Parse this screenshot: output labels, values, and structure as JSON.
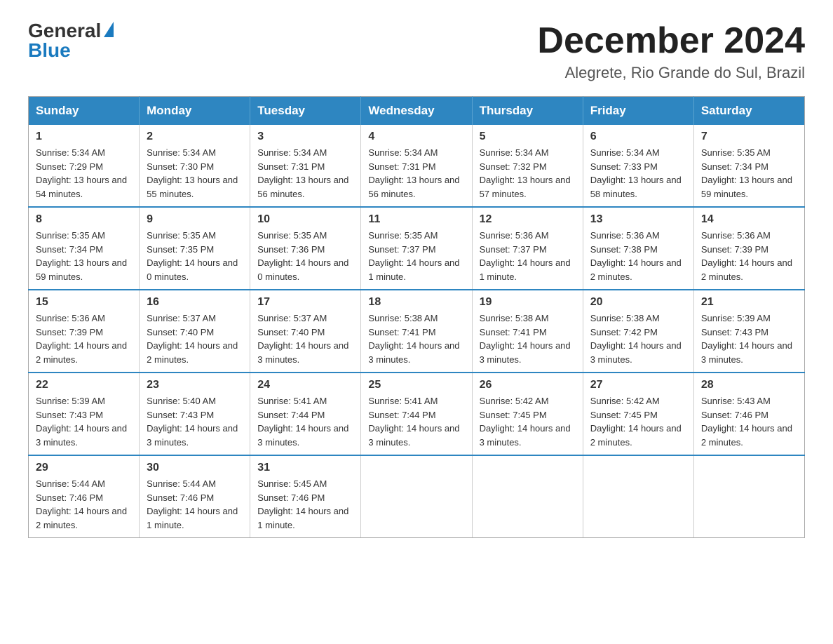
{
  "logo": {
    "general": "General",
    "blue": "Blue"
  },
  "header": {
    "month_title": "December 2024",
    "location": "Alegrete, Rio Grande do Sul, Brazil"
  },
  "days_of_week": [
    "Sunday",
    "Monday",
    "Tuesday",
    "Wednesday",
    "Thursday",
    "Friday",
    "Saturday"
  ],
  "weeks": [
    [
      {
        "day": "1",
        "sunrise": "5:34 AM",
        "sunset": "7:29 PM",
        "daylight": "13 hours and 54 minutes."
      },
      {
        "day": "2",
        "sunrise": "5:34 AM",
        "sunset": "7:30 PM",
        "daylight": "13 hours and 55 minutes."
      },
      {
        "day": "3",
        "sunrise": "5:34 AM",
        "sunset": "7:31 PM",
        "daylight": "13 hours and 56 minutes."
      },
      {
        "day": "4",
        "sunrise": "5:34 AM",
        "sunset": "7:31 PM",
        "daylight": "13 hours and 56 minutes."
      },
      {
        "day": "5",
        "sunrise": "5:34 AM",
        "sunset": "7:32 PM",
        "daylight": "13 hours and 57 minutes."
      },
      {
        "day": "6",
        "sunrise": "5:34 AM",
        "sunset": "7:33 PM",
        "daylight": "13 hours and 58 minutes."
      },
      {
        "day": "7",
        "sunrise": "5:35 AM",
        "sunset": "7:34 PM",
        "daylight": "13 hours and 59 minutes."
      }
    ],
    [
      {
        "day": "8",
        "sunrise": "5:35 AM",
        "sunset": "7:34 PM",
        "daylight": "13 hours and 59 minutes."
      },
      {
        "day": "9",
        "sunrise": "5:35 AM",
        "sunset": "7:35 PM",
        "daylight": "14 hours and 0 minutes."
      },
      {
        "day": "10",
        "sunrise": "5:35 AM",
        "sunset": "7:36 PM",
        "daylight": "14 hours and 0 minutes."
      },
      {
        "day": "11",
        "sunrise": "5:35 AM",
        "sunset": "7:37 PM",
        "daylight": "14 hours and 1 minute."
      },
      {
        "day": "12",
        "sunrise": "5:36 AM",
        "sunset": "7:37 PM",
        "daylight": "14 hours and 1 minute."
      },
      {
        "day": "13",
        "sunrise": "5:36 AM",
        "sunset": "7:38 PM",
        "daylight": "14 hours and 2 minutes."
      },
      {
        "day": "14",
        "sunrise": "5:36 AM",
        "sunset": "7:39 PM",
        "daylight": "14 hours and 2 minutes."
      }
    ],
    [
      {
        "day": "15",
        "sunrise": "5:36 AM",
        "sunset": "7:39 PM",
        "daylight": "14 hours and 2 minutes."
      },
      {
        "day": "16",
        "sunrise": "5:37 AM",
        "sunset": "7:40 PM",
        "daylight": "14 hours and 2 minutes."
      },
      {
        "day": "17",
        "sunrise": "5:37 AM",
        "sunset": "7:40 PM",
        "daylight": "14 hours and 3 minutes."
      },
      {
        "day": "18",
        "sunrise": "5:38 AM",
        "sunset": "7:41 PM",
        "daylight": "14 hours and 3 minutes."
      },
      {
        "day": "19",
        "sunrise": "5:38 AM",
        "sunset": "7:41 PM",
        "daylight": "14 hours and 3 minutes."
      },
      {
        "day": "20",
        "sunrise": "5:38 AM",
        "sunset": "7:42 PM",
        "daylight": "14 hours and 3 minutes."
      },
      {
        "day": "21",
        "sunrise": "5:39 AM",
        "sunset": "7:43 PM",
        "daylight": "14 hours and 3 minutes."
      }
    ],
    [
      {
        "day": "22",
        "sunrise": "5:39 AM",
        "sunset": "7:43 PM",
        "daylight": "14 hours and 3 minutes."
      },
      {
        "day": "23",
        "sunrise": "5:40 AM",
        "sunset": "7:43 PM",
        "daylight": "14 hours and 3 minutes."
      },
      {
        "day": "24",
        "sunrise": "5:41 AM",
        "sunset": "7:44 PM",
        "daylight": "14 hours and 3 minutes."
      },
      {
        "day": "25",
        "sunrise": "5:41 AM",
        "sunset": "7:44 PM",
        "daylight": "14 hours and 3 minutes."
      },
      {
        "day": "26",
        "sunrise": "5:42 AM",
        "sunset": "7:45 PM",
        "daylight": "14 hours and 3 minutes."
      },
      {
        "day": "27",
        "sunrise": "5:42 AM",
        "sunset": "7:45 PM",
        "daylight": "14 hours and 2 minutes."
      },
      {
        "day": "28",
        "sunrise": "5:43 AM",
        "sunset": "7:46 PM",
        "daylight": "14 hours and 2 minutes."
      }
    ],
    [
      {
        "day": "29",
        "sunrise": "5:44 AM",
        "sunset": "7:46 PM",
        "daylight": "14 hours and 2 minutes."
      },
      {
        "day": "30",
        "sunrise": "5:44 AM",
        "sunset": "7:46 PM",
        "daylight": "14 hours and 1 minute."
      },
      {
        "day": "31",
        "sunrise": "5:45 AM",
        "sunset": "7:46 PM",
        "daylight": "14 hours and 1 minute."
      },
      null,
      null,
      null,
      null
    ]
  ],
  "labels": {
    "sunrise": "Sunrise:",
    "sunset": "Sunset:",
    "daylight": "Daylight:"
  }
}
